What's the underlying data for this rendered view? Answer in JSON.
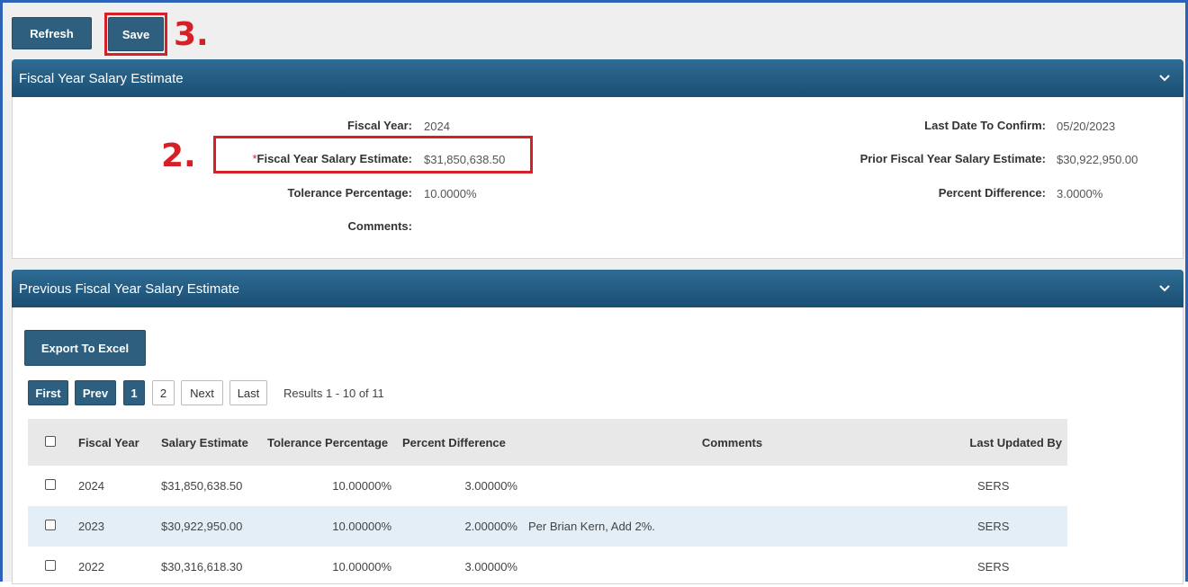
{
  "toolbar": {
    "refresh_label": "Refresh",
    "save_label": "Save"
  },
  "annotations": {
    "step2": "2.",
    "step3": "3."
  },
  "current_panel": {
    "title": "Fiscal Year Salary Estimate",
    "fiscal_year_label": "Fiscal Year:",
    "fiscal_year_value": "2024",
    "required_marker": "*",
    "salary_estimate_label": "Fiscal Year Salary Estimate:",
    "salary_estimate_value": "$31,850,638.50",
    "tolerance_label": "Tolerance Percentage:",
    "tolerance_value": "10.0000%",
    "comments_label": "Comments:",
    "last_date_label": "Last Date To Confirm:",
    "last_date_value": "05/20/2023",
    "prior_estimate_label": "Prior Fiscal Year Salary Estimate:",
    "prior_estimate_value": "$30,922,950.00",
    "percent_diff_label": "Percent Difference:",
    "percent_diff_value": "3.0000%"
  },
  "previous_panel": {
    "title": "Previous Fiscal Year Salary Estimate",
    "export_label": "Export To Excel",
    "pagination": {
      "first": "First",
      "prev": "Prev",
      "page1": "1",
      "page2": "2",
      "next": "Next",
      "last": "Last",
      "results": "Results 1 - 10 of 11"
    },
    "columns": [
      "Fiscal Year",
      "Salary Estimate",
      "Tolerance Percentage",
      "Percent Difference",
      "Comments",
      "Last Updated By"
    ],
    "rows": [
      {
        "year": "2024",
        "salary": "$31,850,638.50",
        "tolerance": "10.00000%",
        "difference": "3.00000%",
        "comments": "",
        "updated_by": "SERS"
      },
      {
        "year": "2023",
        "salary": "$30,922,950.00",
        "tolerance": "10.00000%",
        "difference": "2.00000%",
        "comments": "Per Brian Kern, Add 2%.",
        "updated_by": "SERS"
      },
      {
        "year": "2022",
        "salary": "$30,316,618.30",
        "tolerance": "10.00000%",
        "difference": "3.00000%",
        "comments": "",
        "updated_by": "SERS"
      }
    ]
  }
}
